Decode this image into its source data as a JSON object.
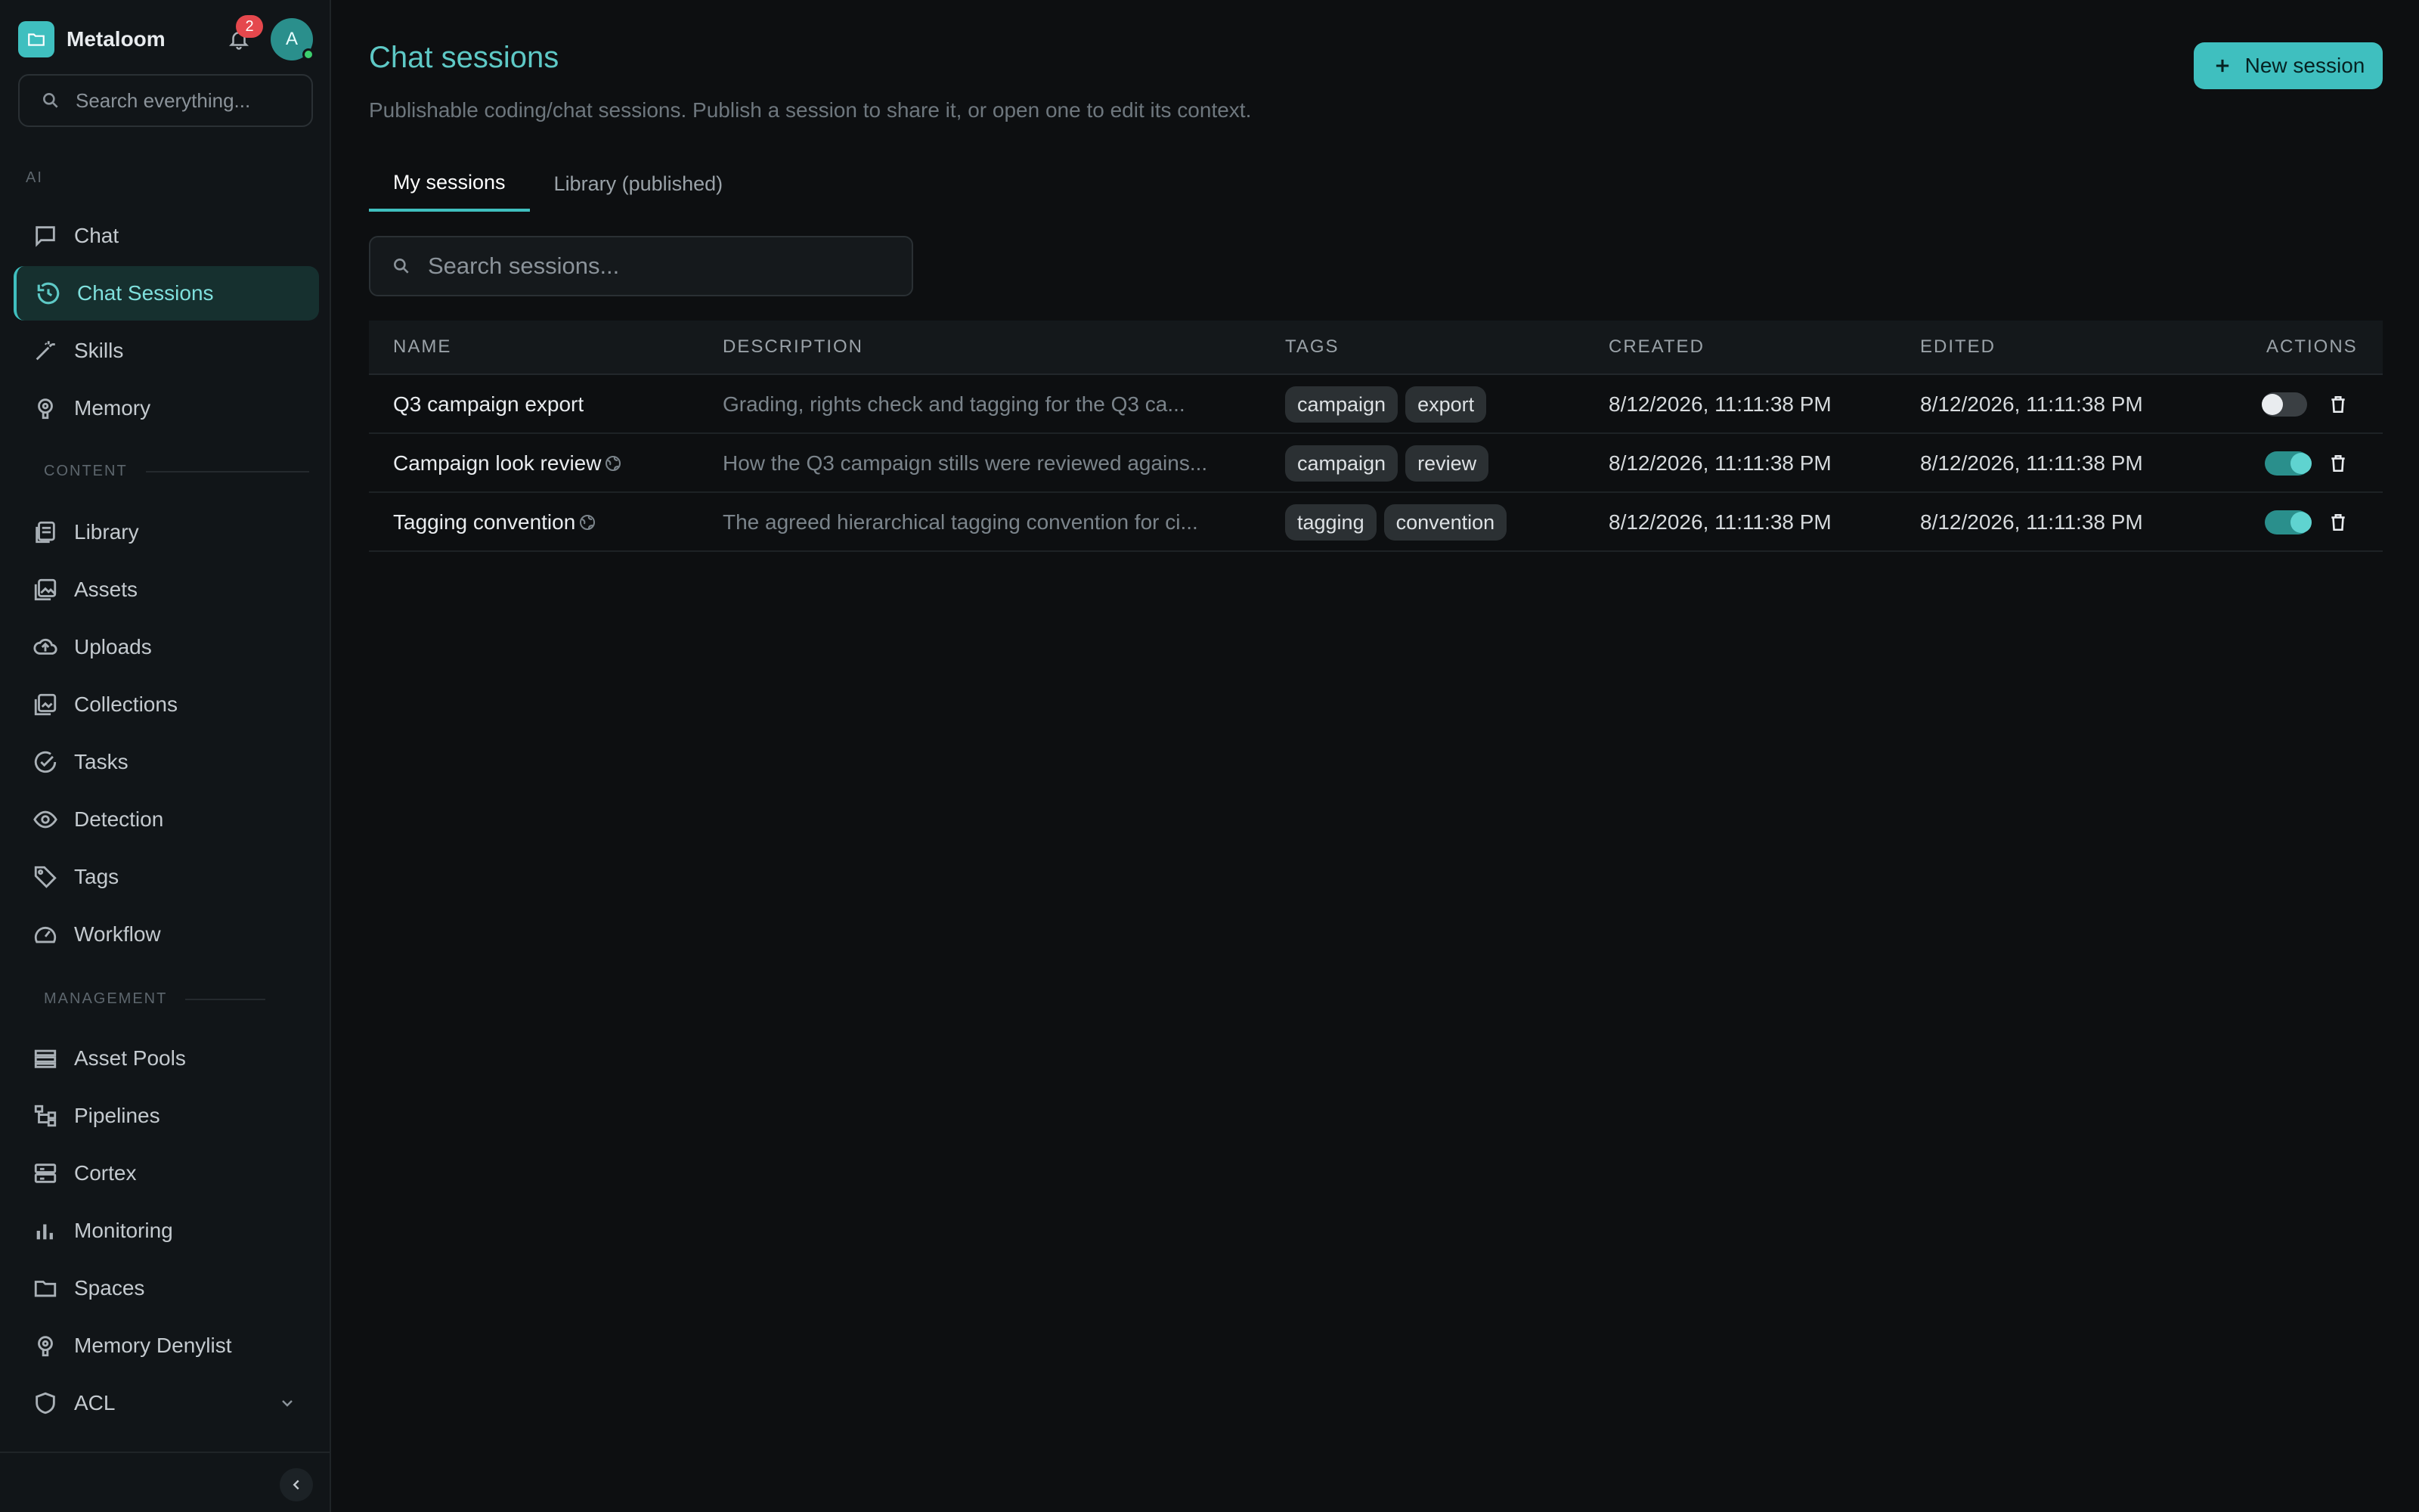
{
  "app": {
    "name": "Metaloom",
    "notification_count": "2",
    "avatar_initial": "A"
  },
  "sidebar": {
    "search_placeholder": "Search everything...",
    "sections": {
      "ai": "AI",
      "content": "CONTENT",
      "management": "MANAGEMENT"
    },
    "items": [
      {
        "label": "Chat",
        "icon": "chat-icon"
      },
      {
        "label": "Chat Sessions",
        "icon": "history-icon",
        "active": true
      },
      {
        "label": "Skills",
        "icon": "wand-icon"
      },
      {
        "label": "Memory",
        "icon": "brain-icon"
      },
      {
        "label": "Library",
        "icon": "library-icon"
      },
      {
        "label": "Assets",
        "icon": "images-icon"
      },
      {
        "label": "Uploads",
        "icon": "cloud-upload-icon"
      },
      {
        "label": "Collections",
        "icon": "collection-icon"
      },
      {
        "label": "Tasks",
        "icon": "check-circle-icon"
      },
      {
        "label": "Detection",
        "icon": "eye-icon"
      },
      {
        "label": "Tags",
        "icon": "tag-icon"
      },
      {
        "label": "Workflow",
        "icon": "gauge-icon"
      },
      {
        "label": "Asset Pools",
        "icon": "list-icon"
      },
      {
        "label": "Pipelines",
        "icon": "hierarchy-icon"
      },
      {
        "label": "Cortex",
        "icon": "server-icon"
      },
      {
        "label": "Monitoring",
        "icon": "bar-chart-icon"
      },
      {
        "label": "Spaces",
        "icon": "folder-icon"
      },
      {
        "label": "Memory Denylist",
        "icon": "brain-icon"
      },
      {
        "label": "ACL",
        "icon": "shield-icon"
      }
    ]
  },
  "main": {
    "title": "Chat sessions",
    "subtitle": "Publishable coding/chat sessions. Publish a session to share it, or open one to edit its context.",
    "new_button": "New session",
    "tabs": [
      {
        "label": "My sessions",
        "active": true
      },
      {
        "label": "Library (published)",
        "active": false
      }
    ],
    "search_placeholder": "Search sessions...",
    "table": {
      "columns": [
        "NAME",
        "DESCRIPTION",
        "TAGS",
        "CREATED",
        "EDITED",
        "ACTIONS"
      ],
      "rows": [
        {
          "name": "Q3 campaign export",
          "published": false,
          "description": "Grading, rights check and tagging for the Q3 ca...",
          "tags": [
            "campaign",
            "export"
          ],
          "created": "8/12/2026, 11:11:38 PM",
          "edited": "8/12/2026, 11:11:38 PM"
        },
        {
          "name": "Campaign look review",
          "published": true,
          "description": "How the Q3 campaign stills were reviewed agains...",
          "tags": [
            "campaign",
            "review"
          ],
          "created": "8/12/2026, 11:11:38 PM",
          "edited": "8/12/2026, 11:11:38 PM"
        },
        {
          "name": "Tagging convention",
          "published": true,
          "description": "The agreed hierarchical tagging convention for ci...",
          "tags": [
            "tagging",
            "convention"
          ],
          "created": "8/12/2026, 11:11:38 PM",
          "edited": "8/12/2026, 11:11:38 PM"
        }
      ]
    }
  },
  "colors": {
    "accent": "#3fbfbf",
    "background": "#0d0f11",
    "sidebar": "#111518",
    "badge": "#e5484d"
  }
}
